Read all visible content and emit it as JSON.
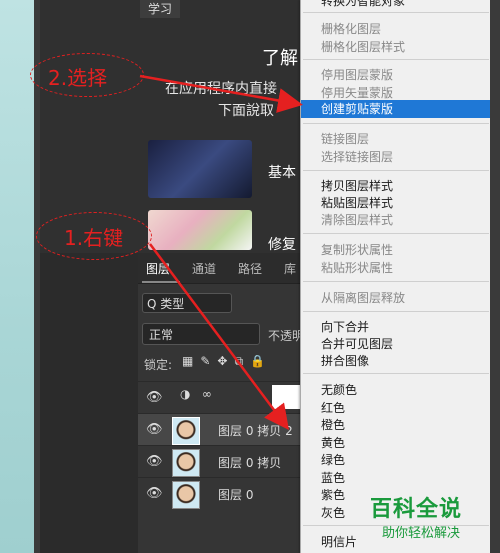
{
  "learn": {
    "tab": "学习",
    "title": "了解",
    "subtitle": "在应用程序内直接",
    "subtitle2": "下面說取",
    "card1_label": "基本",
    "card2_label": "修复"
  },
  "layers": {
    "tabs": [
      "图层",
      "通道",
      "路径",
      "库"
    ],
    "filter_label": "Q 类型",
    "blend_mode": "正常",
    "opacity_label": "不透明",
    "lock_label": "锁定:",
    "rows": [
      {
        "name": "图层 0 拷贝 2"
      },
      {
        "name": "图层 0 拷贝"
      },
      {
        "name": "图层 0"
      }
    ]
  },
  "context_menu": {
    "top_partial": "转换为智能对象",
    "groups": [
      {
        "items": [
          {
            "label": "栅格化图层",
            "disabled": true
          },
          {
            "label": "栅格化图层样式",
            "disabled": true
          }
        ]
      },
      {
        "items": [
          {
            "label": "停用图层蒙版",
            "disabled": true
          },
          {
            "label": "停用矢量蒙版",
            "disabled": true
          },
          {
            "label": "创建剪贴蒙版",
            "highlighted": true
          }
        ]
      },
      {
        "items": [
          {
            "label": "链接图层",
            "disabled": true
          },
          {
            "label": "选择链接图层",
            "disabled": true
          }
        ]
      },
      {
        "items": [
          {
            "label": "拷贝图层样式",
            "disabled": false
          },
          {
            "label": "粘贴图层样式",
            "disabled": false
          },
          {
            "label": "清除图层样式",
            "disabled": true
          }
        ]
      },
      {
        "items": [
          {
            "label": "复制形状属性",
            "disabled": true
          },
          {
            "label": "粘贴形状属性",
            "disabled": true
          }
        ]
      },
      {
        "items": [
          {
            "label": "从隔离图层释放",
            "disabled": true
          }
        ]
      },
      {
        "items": [
          {
            "label": "向下合并",
            "disabled": false
          },
          {
            "label": "合并可见图层",
            "disabled": false
          },
          {
            "label": "拼合图像",
            "disabled": false
          }
        ]
      },
      {
        "items": [
          {
            "label": "无颜色"
          },
          {
            "label": "红色"
          },
          {
            "label": "橙色"
          },
          {
            "label": "黄色"
          },
          {
            "label": "绿色"
          },
          {
            "label": "蓝色"
          },
          {
            "label": "紫色"
          },
          {
            "label": "灰色"
          }
        ]
      },
      {
        "items": [
          {
            "label": "明信片"
          }
        ]
      }
    ]
  },
  "annotations": {
    "step2": "2.选择",
    "step1": "1.右键"
  },
  "watermark": {
    "title": "百科全说",
    "subtitle": "助你轻松解决"
  },
  "colors": {
    "highlight": "#1f78d6",
    "annotation": "#e52020",
    "watermark": "#1a9a3c"
  }
}
